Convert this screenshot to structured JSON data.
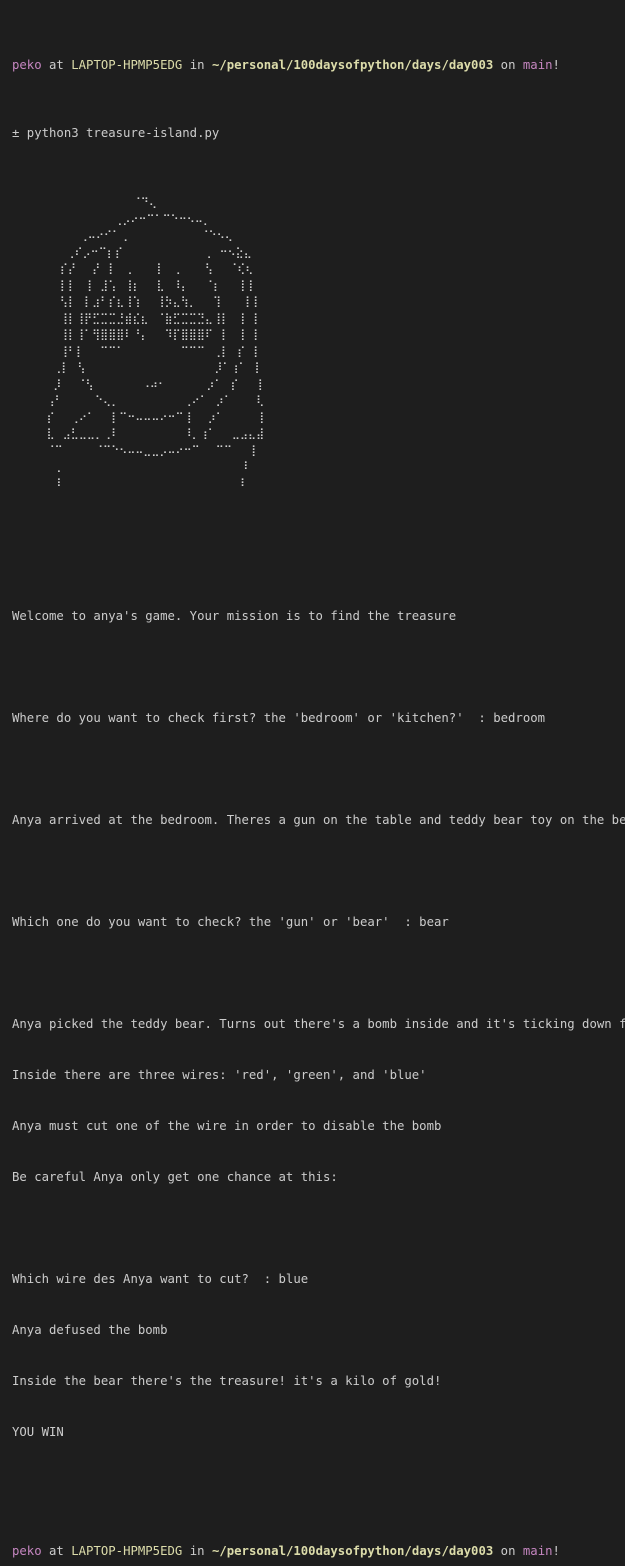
{
  "prompt": {
    "user": "peko",
    "at": " at ",
    "host": "LAPTOP-HPMP5EDG",
    "in": " in ",
    "path": "~/personal/100daysofpython/days/day003",
    "on": " on ",
    "branch": "main",
    "bang": "!"
  },
  "command": "± python3 treasure-island.py",
  "ascii_art": "              ⠈⠙⢄\n          ⠀⢀⡠⠔⠒⠉⠁⠉⠑⠒⠢⠤⡀\n      ⢀⠤⠔⠊⠁⢀⠀⠀⠀⠀⠀⠀⠀⠀⠀⠈⠑⠢⢄\n    ⢀⠎⡠⠒⠉⡆⡎⠀⠀⠀⠀⠀⠀⠀⠀⠀⠀⢀⠀⠒⠢⣕⣄\n   ⡎⡜⠀⠀⡜⠀⡇⠀⢀⠀⠀⠀⡇⠀⢀⠀⠀⠀⢣⠀⠀⠈⢎⢆\n   ⡇⡇⠀⢸⠀⣸⢡⠀⢸⡆⠀⠀⣇⠀⠸⡄⠀⠀⠈⡆⠀⠀⢸⢸\n   ⢣⡇⠀⡇⣰⠃⡎⣆⢸⢱⠀⠀⢸⡳⣄⢳⡀⠀⠀⢹⠀⠀⠀⡇⡇\n   ⢸⡇⢸⡟⣋⣉⣉⣘⣾⣎⣆⠀⠈⣷⣋⣉⣉⣙⣄⢸⡇⠀⢸⠀⡇\n   ⢸⡇⢸⠁⢻⣿⣿⣿⠇⠘⡄⠀⠀⠹⡏⣿⣿⣿⠏⠀⡇⠀⢸⠀⡇\n   ⢸⠃⡇⠀⠀⠉⠉⠁⠀⠀⠀⠀⠀⠀⠀⠉⠉⠉⠀⢀⡇⠀⡎⠀⡇\n  ⢀⡇⠀⢣⠀⠀⠀⠀⠀⠀⠀⠀⠀⠀⠀⠀⠀⠀⠀⠀⡸⠁⢰⠁⠀⡇\n  ⡸⠀⠀⠈⢣⠀⠀⠀⠀⠀⠀⠠⠴⠂⠀⠀⠀⠀⠀⡰⠁⠀⡎⠀⠀⢸\n ⢠⠃⠀⠀⠀⠀⠑⢄⡀⠀⠀⠀⠀⠀⠀⠀⠀⢀⠔⠁⠀⡰⠁⠀⠀⠀⢇\n ⡎⠀⠀⢀⠔⠁⠀⠀⡇⠉⠒⠤⠤⠤⠔⠒⠉⢸⠀⠀⡰⠁⠀⠀⠀⠀⢸\n ⣇⠀⣠⣃⣀⣀⡀⢀⠇⠀⠀⠀⠀⠀⠀⠀⠀⠸⡀⢰⠁⠀⠀⣀⣠⣄⣼\n ⠈⠉⠀⠀⠀⠀⠈⠉⠑⠢⠤⠤⣀⣀⡠⠤⠔⠒⠉⠀⠀⠉⠉⠀⠀⢸\n  ⢀                           ⠸\n  ⠸                           ⠇",
  "output": {
    "welcome": "Welcome to anya's game. Your mission is to find the treasure",
    "q1": "Where do you want to check first? the 'bedroom' or 'kitchen?'  : bedroom",
    "arrived": "Anya arrived at the bedroom. Theres a gun on the table and teddy bear toy on the bed",
    "q2": "Which one do you want to check? the 'gun' or 'bear'  : bear",
    "picked": "Anya picked the teddy bear. Turns out there's a bomb inside and it's ticking down fast",
    "wires": "Inside there are three wires: 'red', 'green', and 'blue'",
    "mustcut": "Anya must cut one of the wire in order to disable the bomb",
    "careful": "Be careful Anya only get one chance at this:",
    "q3": "Which wire des Anya want to cut?  : blue",
    "defused": "Anya defused the bomb",
    "treasure": "Inside the bear there's the treasure! it's a kilo of gold!",
    "win": "YOU WIN"
  },
  "prompt2": {
    "user": "peko",
    "at": " at ",
    "host": "LAPTOP-HPMP5EDG",
    "in": " in ",
    "path": "~/personal/100daysofpython/days/day003",
    "on": " on ",
    "branch": "main",
    "bang": "!"
  },
  "cursor_line": "±",
  "colors": {
    "background": "#1e1e1e",
    "text": "#cccccc",
    "user": "#c586c0",
    "host": "#dcdcaa",
    "path": "#dcdcaa",
    "branch": "#c586c0"
  }
}
